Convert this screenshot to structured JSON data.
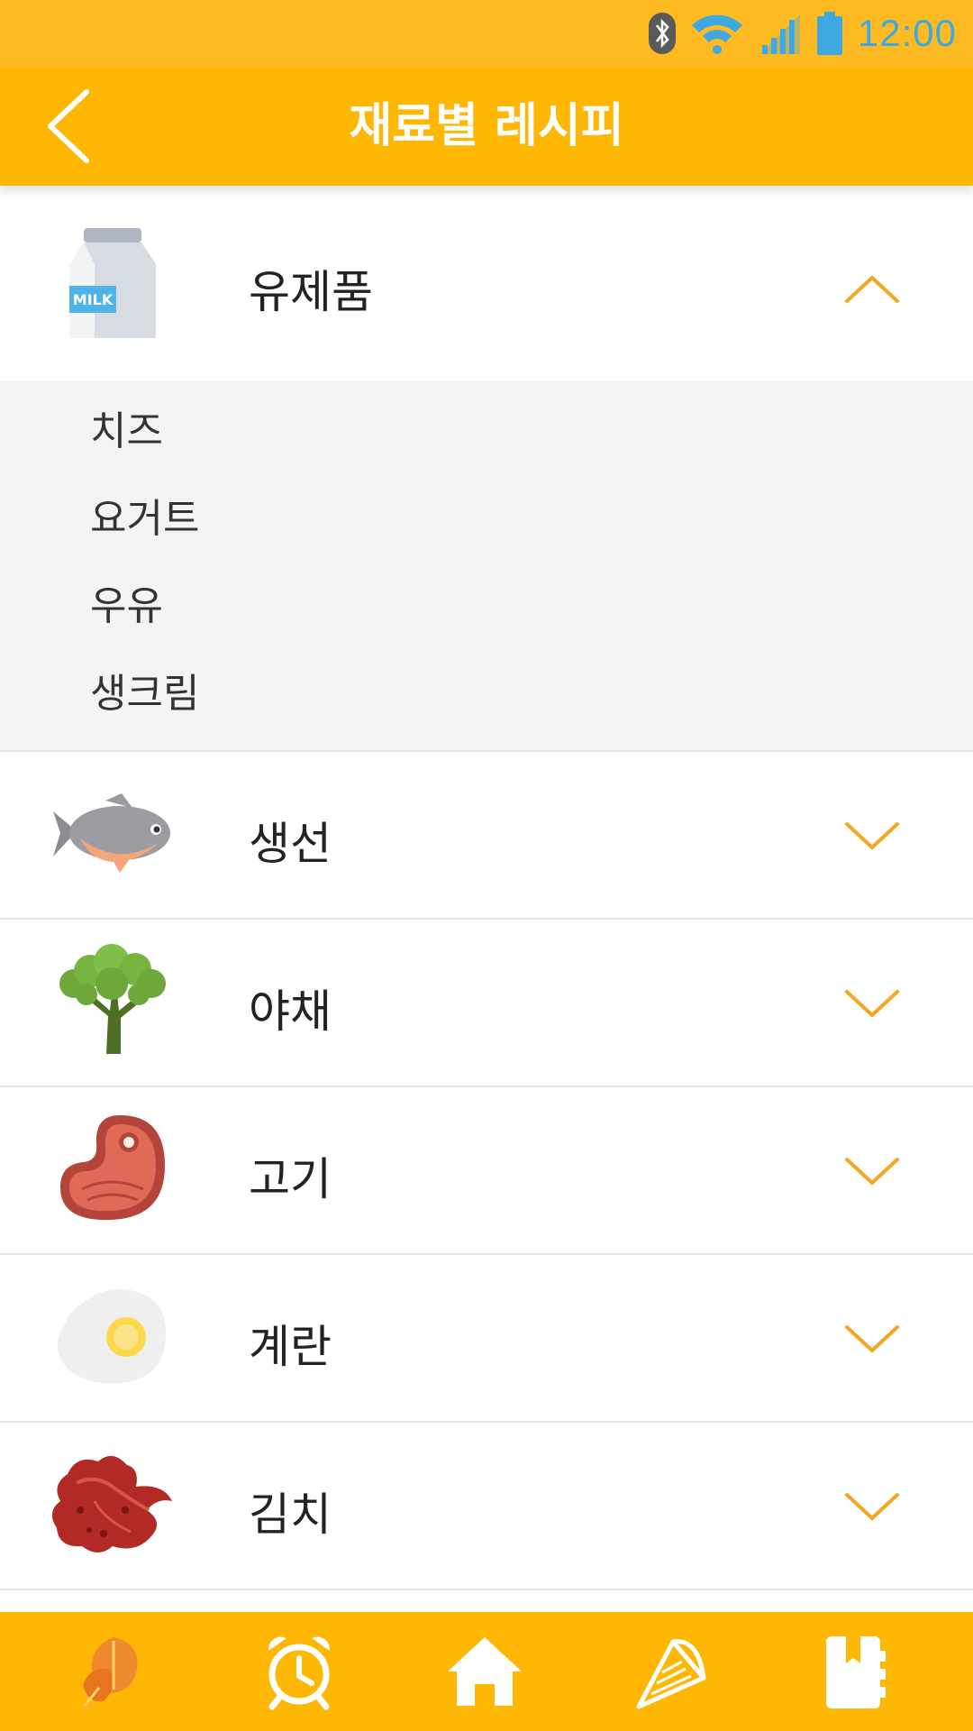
{
  "status_bar": {
    "time": "12:00",
    "icons": [
      "bluetooth-icon",
      "wifi-icon",
      "signal-icon",
      "battery-icon"
    ]
  },
  "app_bar": {
    "title": "재료별 레시피",
    "back_icon": "back-arrow-icon"
  },
  "categories": [
    {
      "label": "유제품",
      "icon": "milk-carton-icon",
      "expanded": true,
      "icon_text": "MILK",
      "sub_items": [
        "치즈",
        "요거트",
        "우유",
        "생크림"
      ]
    },
    {
      "label": "생선",
      "icon": "fish-icon",
      "expanded": false
    },
    {
      "label": "야채",
      "icon": "broccoli-icon",
      "expanded": false
    },
    {
      "label": "고기",
      "icon": "steak-icon",
      "expanded": false
    },
    {
      "label": "계란",
      "icon": "fried-egg-icon",
      "expanded": false
    },
    {
      "label": "김치",
      "icon": "kimchi-icon",
      "expanded": false
    }
  ],
  "bottom_nav": {
    "items": [
      "spinach-icon",
      "alarm-clock-icon",
      "home-icon",
      "strainer-icon",
      "recipe-book-icon"
    ]
  },
  "colors": {
    "accent": "#FEB705",
    "status_bar": "#FDBA23",
    "chevron": "#F5A623",
    "time": "#3DA9E0"
  }
}
